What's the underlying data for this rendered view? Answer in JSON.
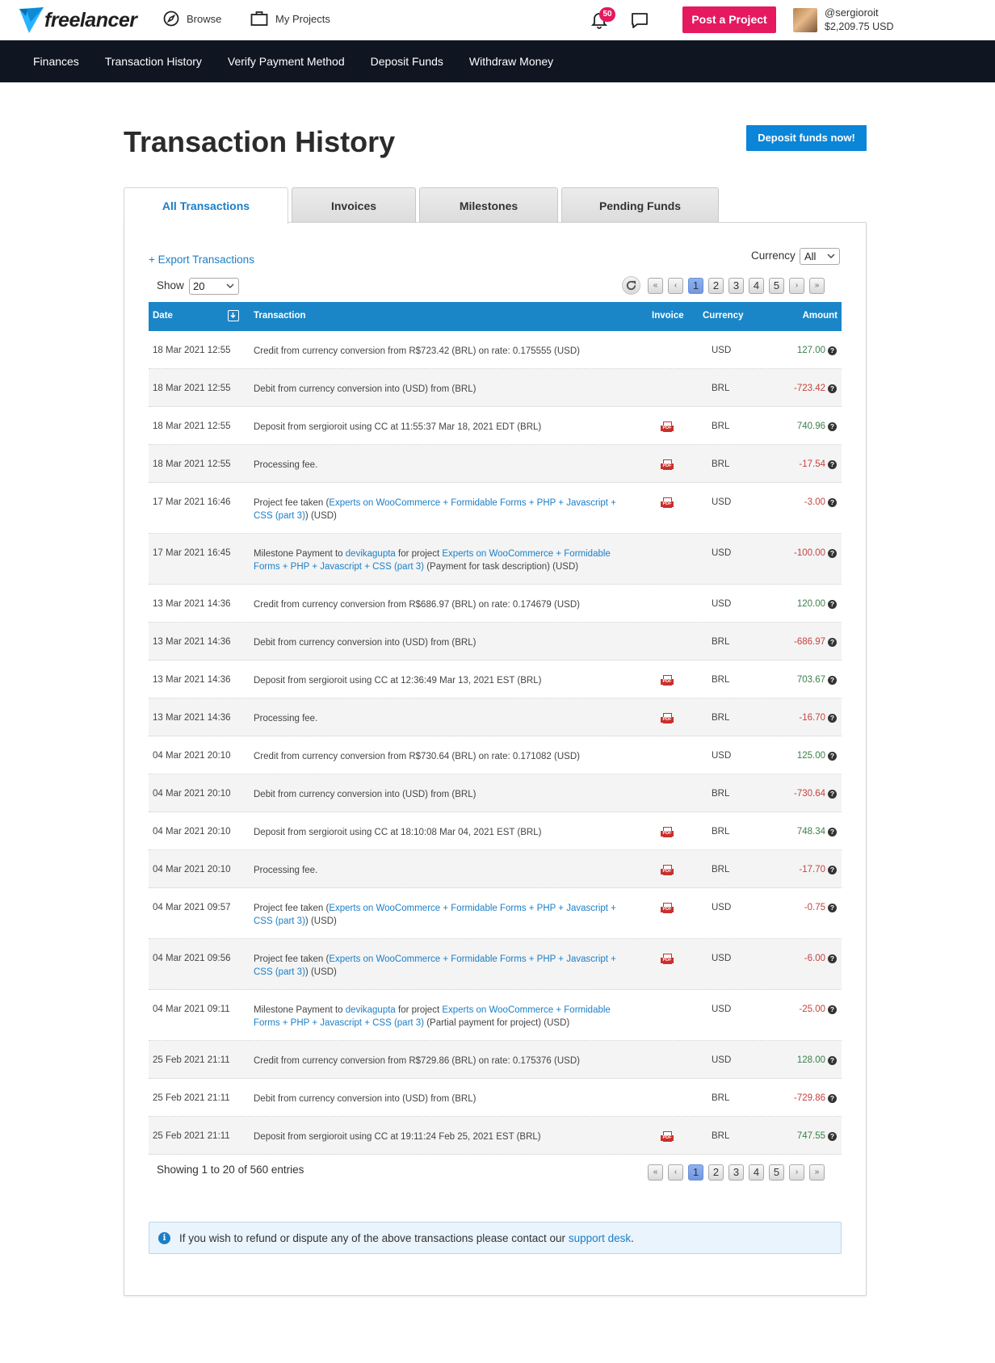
{
  "brand": {
    "name": "freelancer"
  },
  "topnav": {
    "browse": "Browse",
    "my_projects": "My Projects",
    "notifications_count": "50",
    "post_project": "Post a Project",
    "username": "@sergioroit",
    "balance": "$2,209.75 USD"
  },
  "subnav": [
    "Finances",
    "Transaction History",
    "Verify Payment Method",
    "Deposit Funds",
    "Withdraw Money"
  ],
  "page": {
    "title": "Transaction History",
    "deposit_button": "Deposit funds now!"
  },
  "tabs": [
    "All Transactions",
    "Invoices",
    "Milestones",
    "Pending Funds"
  ],
  "controls": {
    "export": "+ Export Transactions",
    "currency_label": "Currency",
    "currency_value": "All",
    "show_label": "Show",
    "show_value": "20"
  },
  "pagination": {
    "first": "«",
    "prev": "‹",
    "next": "›",
    "last": "»",
    "pages": [
      "1",
      "2",
      "3",
      "4",
      "5"
    ],
    "current": "1"
  },
  "table": {
    "headers": {
      "date": "Date",
      "transaction": "Transaction",
      "invoice": "Invoice",
      "currency": "Currency",
      "amount": "Amount"
    },
    "rows": [
      {
        "date": "18 Mar 2021 12:55",
        "parts": [
          {
            "t": "Credit from currency conversion from R$723.42 (BRL) on rate: 0.175555 (USD)"
          }
        ],
        "pdf": false,
        "currency": "USD",
        "amount": "127.00",
        "sign": "pos"
      },
      {
        "date": "18 Mar 2021 12:55",
        "parts": [
          {
            "t": "Debit from currency conversion into (USD) from (BRL)"
          }
        ],
        "pdf": false,
        "currency": "BRL",
        "amount": "-723.42",
        "sign": "neg"
      },
      {
        "date": "18 Mar 2021 12:55",
        "parts": [
          {
            "t": "Deposit from sergioroit using CC at 11:55:37 Mar 18, 2021 EDT (BRL)"
          }
        ],
        "pdf": true,
        "currency": "BRL",
        "amount": "740.96",
        "sign": "pos"
      },
      {
        "date": "18 Mar 2021 12:55",
        "parts": [
          {
            "t": "Processing fee."
          }
        ],
        "pdf": true,
        "currency": "BRL",
        "amount": "-17.54",
        "sign": "neg"
      },
      {
        "date": "17 Mar 2021 16:46",
        "parts": [
          {
            "t": "Project fee taken ("
          },
          {
            "t": "Experts on WooCommerce + Formidable Forms + PHP + Javascript + CSS (part 3)",
            "link": true
          },
          {
            "t": ") (USD)"
          }
        ],
        "pdf": true,
        "currency": "USD",
        "amount": "-3.00",
        "sign": "neg"
      },
      {
        "date": "17 Mar 2021 16:45",
        "parts": [
          {
            "t": "Milestone Payment to "
          },
          {
            "t": "devikagupta",
            "link": true
          },
          {
            "t": " for project "
          },
          {
            "t": "Experts on WooCommerce + Formidable Forms + PHP + Javascript + CSS (part 3)",
            "link": true
          },
          {
            "t": " (Payment for task description) (USD)"
          }
        ],
        "pdf": false,
        "currency": "USD",
        "amount": "-100.00",
        "sign": "neg"
      },
      {
        "date": "13 Mar 2021 14:36",
        "parts": [
          {
            "t": "Credit from currency conversion from R$686.97 (BRL) on rate: 0.174679 (USD)"
          }
        ],
        "pdf": false,
        "currency": "USD",
        "amount": "120.00",
        "sign": "pos"
      },
      {
        "date": "13 Mar 2021 14:36",
        "parts": [
          {
            "t": "Debit from currency conversion into (USD) from (BRL)"
          }
        ],
        "pdf": false,
        "currency": "BRL",
        "amount": "-686.97",
        "sign": "neg"
      },
      {
        "date": "13 Mar 2021 14:36",
        "parts": [
          {
            "t": "Deposit from sergioroit using CC at 12:36:49 Mar 13, 2021 EST (BRL)"
          }
        ],
        "pdf": true,
        "currency": "BRL",
        "amount": "703.67",
        "sign": "pos"
      },
      {
        "date": "13 Mar 2021 14:36",
        "parts": [
          {
            "t": "Processing fee."
          }
        ],
        "pdf": true,
        "currency": "BRL",
        "amount": "-16.70",
        "sign": "neg"
      },
      {
        "date": "04 Mar 2021 20:10",
        "parts": [
          {
            "t": "Credit from currency conversion from R$730.64 (BRL) on rate: 0.171082 (USD)"
          }
        ],
        "pdf": false,
        "currency": "USD",
        "amount": "125.00",
        "sign": "pos"
      },
      {
        "date": "04 Mar 2021 20:10",
        "parts": [
          {
            "t": "Debit from currency conversion into (USD) from (BRL)"
          }
        ],
        "pdf": false,
        "currency": "BRL",
        "amount": "-730.64",
        "sign": "neg"
      },
      {
        "date": "04 Mar 2021 20:10",
        "parts": [
          {
            "t": "Deposit from sergioroit using CC at 18:10:08 Mar 04, 2021 EST (BRL)"
          }
        ],
        "pdf": true,
        "currency": "BRL",
        "amount": "748.34",
        "sign": "pos"
      },
      {
        "date": "04 Mar 2021 20:10",
        "parts": [
          {
            "t": "Processing fee."
          }
        ],
        "pdf": true,
        "currency": "BRL",
        "amount": "-17.70",
        "sign": "neg"
      },
      {
        "date": "04 Mar 2021 09:57",
        "parts": [
          {
            "t": "Project fee taken ("
          },
          {
            "t": "Experts on WooCommerce + Formidable Forms + PHP + Javascript + CSS (part 3)",
            "link": true
          },
          {
            "t": ") (USD)"
          }
        ],
        "pdf": true,
        "currency": "USD",
        "amount": "-0.75",
        "sign": "neg"
      },
      {
        "date": "04 Mar 2021 09:56",
        "parts": [
          {
            "t": "Project fee taken ("
          },
          {
            "t": "Experts on WooCommerce + Formidable Forms + PHP + Javascript + CSS (part 3)",
            "link": true
          },
          {
            "t": ") (USD)"
          }
        ],
        "pdf": true,
        "currency": "USD",
        "amount": "-6.00",
        "sign": "neg"
      },
      {
        "date": "04 Mar 2021 09:11",
        "parts": [
          {
            "t": "Milestone Payment to "
          },
          {
            "t": "devikagupta",
            "link": true
          },
          {
            "t": " for project "
          },
          {
            "t": "Experts on WooCommerce + Formidable Forms + PHP + Javascript + CSS (part 3)",
            "link": true
          },
          {
            "t": " (Partial payment for project) (USD)"
          }
        ],
        "pdf": false,
        "currency": "USD",
        "amount": "-25.00",
        "sign": "neg"
      },
      {
        "date": "25 Feb 2021 21:11",
        "parts": [
          {
            "t": "Credit from currency conversion from R$729.86 (BRL) on rate: 0.175376 (USD)"
          }
        ],
        "pdf": false,
        "currency": "USD",
        "amount": "128.00",
        "sign": "pos"
      },
      {
        "date": "25 Feb 2021 21:11",
        "parts": [
          {
            "t": "Debit from currency conversion into (USD) from (BRL)"
          }
        ],
        "pdf": false,
        "currency": "BRL",
        "amount": "-729.86",
        "sign": "neg"
      },
      {
        "date": "25 Feb 2021 21:11",
        "parts": [
          {
            "t": "Deposit from sergioroit using CC at 19:11:24 Feb 25, 2021 EST (BRL)"
          }
        ],
        "pdf": true,
        "currency": "BRL",
        "amount": "747.55",
        "sign": "pos"
      }
    ]
  },
  "footer": {
    "showing": "Showing 1 to 20 of 560 entries",
    "info_text": "If you wish to refund or dispute any of the above transactions please contact our",
    "support_link": "support desk",
    "info_end": "."
  },
  "icons": {
    "pdf_label": "PDF",
    "help": "?",
    "info": "i"
  },
  "colors": {
    "brand_blue": "#1a86c8",
    "pink": "#e5195f",
    "navy": "#0f1521",
    "positive": "#3a7f4a",
    "negative": "#c4433d"
  }
}
